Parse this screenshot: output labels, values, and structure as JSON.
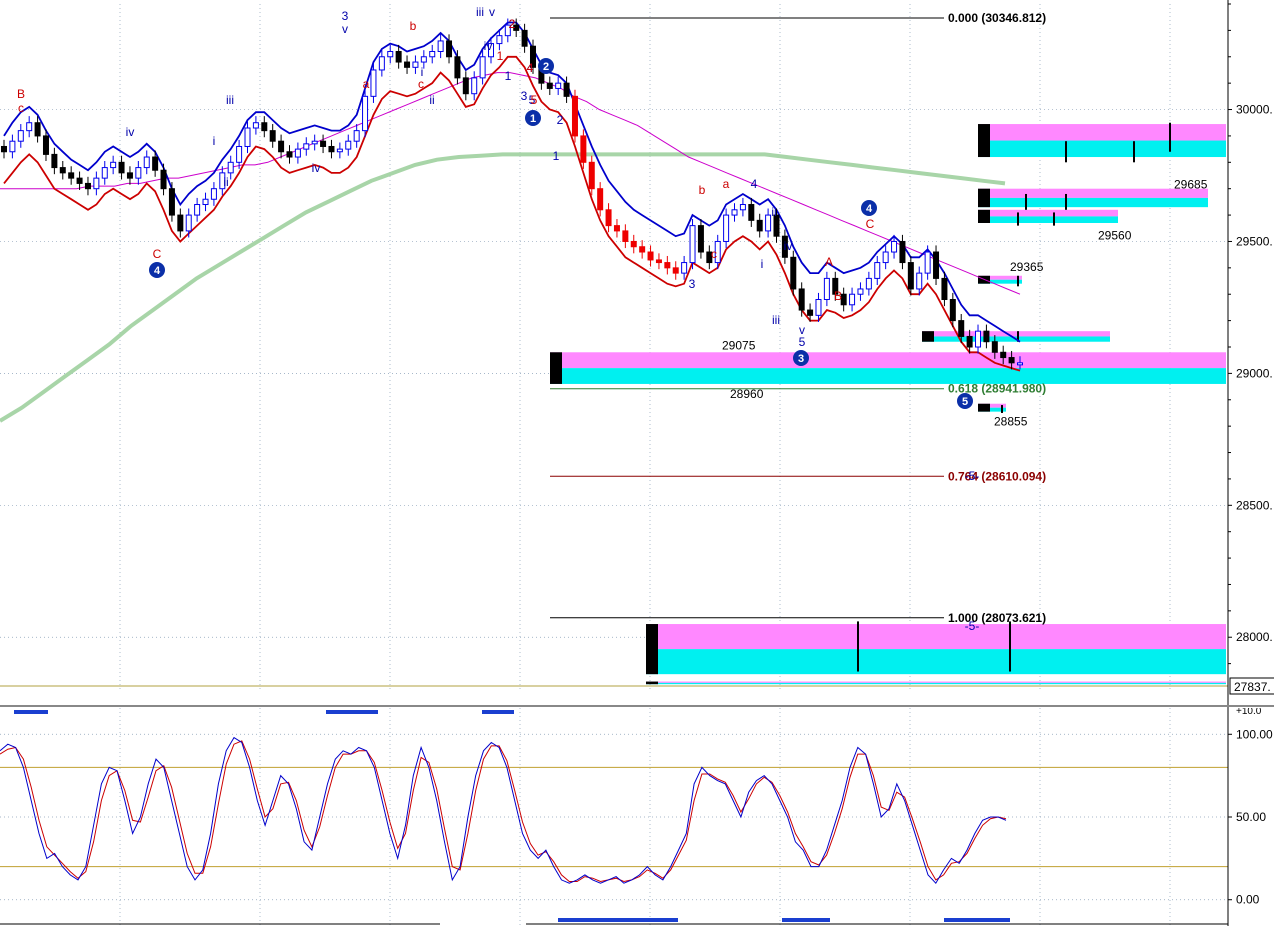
{
  "chart_data": [
    {
      "type": "candlestick",
      "ylim": [
        27800,
        30400
      ],
      "y_ticks": [
        {
          "value": 30000,
          "label": "30000."
        },
        {
          "value": 29500,
          "label": "29500."
        },
        {
          "value": 29000,
          "label": "29000."
        },
        {
          "value": 28500,
          "label": "28500."
        },
        {
          "value": 28000,
          "label": "28000."
        }
      ],
      "last_price": {
        "value": 27837,
        "label": "27837."
      },
      "fib_levels": [
        {
          "value": 30346.812,
          "label": "0.000 (30346.812)",
          "color": "#000000"
        },
        {
          "value": 28941.98,
          "label": "0.618 (28941.980)",
          "color": "#2e7d32"
        },
        {
          "value": 28610.094,
          "label": "0.764 (28610.094)",
          "color": "#8b0000"
        },
        {
          "value": 28073.621,
          "label": "1.000 (28073.621)",
          "color": "#000000"
        }
      ],
      "price_labels": [
        {
          "value": 29685,
          "label": "29685"
        },
        {
          "value": 29560,
          "label": "29560"
        },
        {
          "value": 29365,
          "label": "29365"
        },
        {
          "value": 29075,
          "label": "29075"
        },
        {
          "value": 28960,
          "label": "28960"
        },
        {
          "value": 28855,
          "label": "28855"
        }
      ],
      "wave_labels_blue": [
        "3",
        "v",
        "iii",
        "v",
        "2",
        "iv",
        "i",
        "ii",
        "iv",
        "iii",
        "1",
        "2",
        "3",
        "4",
        "5",
        "ii",
        "iv",
        "iii",
        "v",
        "5",
        "4",
        "i",
        "3",
        "ii",
        "i",
        "iv",
        "1",
        "-5-",
        "-5-"
      ],
      "wave_labels_red": [
        "B",
        "c",
        "C",
        "b",
        "a",
        "c",
        "a",
        "b",
        "c",
        "A",
        "B",
        "C",
        "2",
        "1",
        "4",
        "5"
      ],
      "circled_waves": [
        "1",
        "2",
        "3",
        "4",
        "4",
        "5"
      ],
      "series": [
        {
          "name": "",
          "role": "price",
          "color": "#000000",
          "values": [
            29840,
            29880,
            29920,
            29950,
            29900,
            29830,
            29780,
            29760,
            29740,
            29720,
            29700,
            29740,
            29780,
            29800,
            29760,
            29740,
            29780,
            29820,
            29770,
            29700,
            29600,
            29540,
            29600,
            29640,
            29660,
            29700,
            29760,
            29800,
            29860,
            29930,
            29950,
            29920,
            29880,
            29840,
            29820,
            29850,
            29870,
            29880,
            29860,
            29840,
            29850,
            29880,
            29920,
            30050,
            30150,
            30200,
            30220,
            30180,
            30160,
            30180,
            30200,
            30220,
            30260,
            30200,
            30120,
            30060,
            30120,
            30200,
            30250,
            30280,
            30320,
            30300,
            30240,
            30160,
            30100,
            30080,
            30100,
            30050,
            29900,
            29800,
            29700,
            29620,
            29560,
            29540,
            29500,
            29480,
            29460,
            29430,
            29420,
            29400,
            29380,
            29420,
            29560,
            29460,
            29420,
            29500,
            29600,
            29620,
            29640,
            29580,
            29540,
            29600,
            29520,
            29440,
            29320,
            29240,
            29220,
            29280,
            29360,
            29300,
            29260,
            29300,
            29320,
            29360,
            29420,
            29460,
            29500,
            29420,
            29320,
            29380,
            29460,
            29360,
            29280,
            29200,
            29140,
            29100,
            29160,
            29120,
            29080,
            29060,
            29040,
            29040
          ]
        },
        {
          "name": "",
          "role": "upper band",
          "color": "#0000cc",
          "values": [
            29900,
            29950,
            29990,
            30010,
            29980,
            29920,
            29870,
            29840,
            29810,
            29790,
            29770,
            29800,
            29840,
            29860,
            29840,
            29820,
            29840,
            29870,
            29840,
            29780,
            29700,
            29640,
            29680,
            29710,
            29730,
            29760,
            29810,
            29850,
            29900,
            29960,
            29990,
            29990,
            29960,
            29930,
            29910,
            29920,
            29930,
            29940,
            29930,
            29920,
            29920,
            29940,
            29980,
            30080,
            30180,
            30230,
            30250,
            30240,
            30220,
            30230,
            30240,
            30260,
            30290,
            30260,
            30200,
            30150,
            30170,
            30230,
            30270,
            30300,
            30330,
            30330,
            30290,
            30230,
            30170,
            30140,
            30130,
            30100,
            30020,
            29940,
            29860,
            29790,
            29730,
            29690,
            29650,
            29620,
            29600,
            29580,
            29560,
            29540,
            29520,
            29530,
            29600,
            29580,
            29560,
            29580,
            29640,
            29660,
            29680,
            29660,
            29640,
            29660,
            29620,
            29560,
            29480,
            29420,
            29380,
            29380,
            29420,
            29400,
            29380,
            29390,
            29400,
            29420,
            29460,
            29490,
            29520,
            29490,
            29440,
            29440,
            29470,
            29430,
            29380,
            29320,
            29260,
            29220,
            29220,
            29200,
            29180,
            29160,
            29140,
            29120
          ]
        },
        {
          "name": "",
          "role": "lower band",
          "color": "#cc0000",
          "values": [
            29720,
            29760,
            29800,
            29830,
            29800,
            29750,
            29700,
            29680,
            29660,
            29640,
            29620,
            29640,
            29680,
            29700,
            29680,
            29660,
            29680,
            29720,
            29690,
            29620,
            29540,
            29500,
            29530,
            29560,
            29590,
            29620,
            29670,
            29710,
            29760,
            29820,
            29860,
            29850,
            29820,
            29780,
            29760,
            29770,
            29780,
            29790,
            29780,
            29760,
            29760,
            29780,
            29820,
            29900,
            29980,
            30040,
            30070,
            30060,
            30050,
            30060,
            30080,
            30100,
            30140,
            30110,
            30060,
            30010,
            30020,
            30080,
            30130,
            30160,
            30200,
            30200,
            30160,
            30090,
            30030,
            30000,
            29990,
            29950,
            29860,
            29760,
            29660,
            29580,
            29520,
            29480,
            29440,
            29420,
            29400,
            29380,
            29360,
            29340,
            29330,
            29340,
            29420,
            29400,
            29380,
            29400,
            29470,
            29500,
            29520,
            29500,
            29470,
            29500,
            29450,
            29380,
            29300,
            29240,
            29200,
            29200,
            29240,
            29230,
            29210,
            29220,
            29240,
            29270,
            29320,
            29360,
            29390,
            29360,
            29300,
            29300,
            29340,
            29300,
            29240,
            29180,
            29120,
            29080,
            29080,
            29060,
            29040,
            29030,
            29020,
            29010
          ]
        },
        {
          "name": "",
          "role": "slow MA",
          "color": "#cc00cc",
          "values": [
            29700,
            29700,
            29700,
            29700,
            29700,
            29700,
            29700,
            29710,
            29710,
            29710,
            29720,
            29720,
            29730,
            29740,
            29740,
            29750,
            29760,
            29770,
            29780,
            29790,
            29790,
            29800,
            29820,
            29840,
            29860,
            29880,
            29900,
            29920,
            29940,
            29960,
            29980,
            30000,
            30020,
            30040,
            30060,
            30080,
            30100,
            30120,
            30130,
            30140,
            30140,
            30130,
            30120,
            30100,
            30080,
            30050,
            30030,
            30000,
            29980,
            29960,
            29940,
            29910,
            29880,
            29850,
            29820,
            29800,
            29780,
            29760,
            29740,
            29720,
            29700,
            29680,
            29660,
            29640,
            29620,
            29600,
            29580,
            29560,
            29540,
            29520,
            29500,
            29480,
            29460,
            29440,
            29420,
            29400,
            29380,
            29360,
            29340,
            29320,
            29300
          ]
        },
        {
          "name": "",
          "role": "long MA",
          "color": "#a8d5a8",
          "values": [
            28820,
            28870,
            28930,
            28990,
            29050,
            29110,
            29180,
            29240,
            29300,
            29360,
            29410,
            29460,
            29510,
            29560,
            29610,
            29650,
            29690,
            29730,
            29760,
            29790,
            29810,
            29820,
            29825,
            29830,
            29830,
            29830,
            29830,
            29830,
            29830,
            29830,
            29830,
            29830,
            29830,
            29830,
            29830,
            29830,
            29820,
            29810,
            29800,
            29790,
            29780,
            29770,
            29760,
            29750,
            29740,
            29730,
            29720
          ]
        }
      ]
    },
    {
      "type": "line",
      "ylim": [
        -5,
        105
      ],
      "y_ticks": [
        {
          "value": 100,
          "label": "100.00"
        },
        {
          "value": 50,
          "label": "50.00"
        },
        {
          "value": 0,
          "label": "0.00"
        }
      ],
      "top_clip_label": "+10.0",
      "bands": [
        80,
        20
      ],
      "series": [
        {
          "name": "",
          "color": "#0000cc",
          "values": [
            90,
            94,
            92,
            80,
            60,
            40,
            25,
            28,
            20,
            15,
            12,
            20,
            45,
            70,
            80,
            78,
            60,
            40,
            50,
            70,
            85,
            80,
            60,
            40,
            20,
            12,
            18,
            40,
            70,
            90,
            98,
            95,
            80,
            60,
            45,
            60,
            75,
            70,
            55,
            35,
            30,
            50,
            70,
            85,
            90,
            88,
            92,
            90,
            80,
            60,
            40,
            25,
            45,
            75,
            92,
            80,
            60,
            35,
            12,
            20,
            50,
            75,
            90,
            95,
            92,
            80,
            60,
            40,
            30,
            25,
            30,
            20,
            12,
            10,
            12,
            15,
            12,
            10,
            12,
            14,
            10,
            12,
            15,
            20,
            15,
            12,
            20,
            30,
            40,
            70,
            80,
            75,
            72,
            70,
            60,
            50,
            65,
            72,
            75,
            70,
            60,
            50,
            35,
            30,
            20,
            20,
            30,
            45,
            60,
            80,
            92,
            88,
            70,
            50,
            55,
            70,
            60,
            45,
            30,
            15,
            10,
            18,
            25,
            22,
            30,
            40,
            48,
            50,
            50,
            48
          ]
        },
        {
          "name": "",
          "color": "#cc0000",
          "values": [
            88,
            91,
            92,
            85,
            68,
            48,
            32,
            27,
            22,
            17,
            13,
            17,
            35,
            60,
            75,
            78,
            66,
            48,
            47,
            62,
            78,
            81,
            68,
            48,
            28,
            16,
            16,
            32,
            58,
            82,
            94,
            96,
            85,
            67,
            50,
            55,
            70,
            71,
            60,
            42,
            32,
            44,
            63,
            80,
            88,
            88,
            90,
            90,
            83,
            66,
            47,
            31,
            40,
            66,
            86,
            83,
            67,
            43,
            20,
            18,
            40,
            66,
            85,
            93,
            93,
            84,
            66,
            47,
            34,
            27,
            29,
            23,
            15,
            11,
            11,
            14,
            13,
            11,
            12,
            13,
            11,
            12,
            14,
            18,
            16,
            13,
            18,
            27,
            36,
            60,
            76,
            76,
            73,
            71,
            63,
            53,
            61,
            70,
            74,
            71,
            63,
            53,
            40,
            32,
            23,
            21,
            27,
            40,
            55,
            74,
            88,
            88,
            75,
            56,
            54,
            65,
            62,
            49,
            35,
            20,
            12,
            15,
            22,
            23,
            28,
            37,
            45,
            49,
            50,
            49
          ]
        }
      ]
    }
  ]
}
